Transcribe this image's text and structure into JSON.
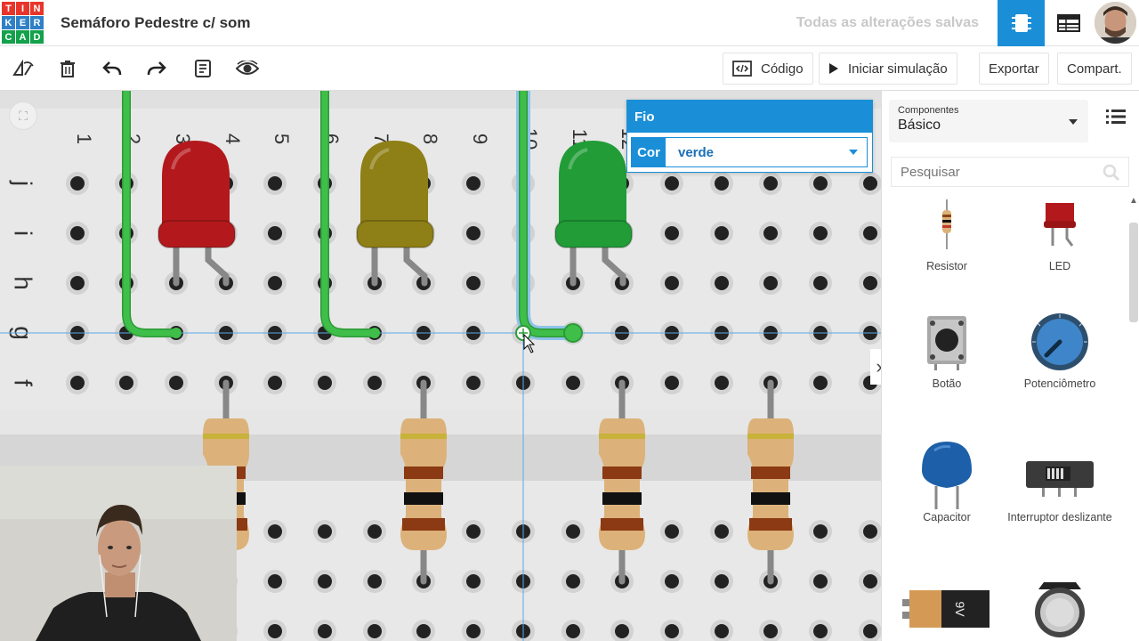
{
  "header": {
    "logo_letters": [
      "T",
      "I",
      "N",
      "K",
      "E",
      "R",
      "C",
      "A",
      "D"
    ],
    "logo_colors": [
      "#e8352b",
      "#e8352b",
      "#e8352b",
      "#2f80c6",
      "#2f80c6",
      "#2f80c6",
      "#13a14b",
      "#13a14b",
      "#13a14b"
    ],
    "title": "Semáforo Pedestre c/ som",
    "save_status": "Todas as alterações salvas"
  },
  "toolbar": {
    "code_label": "Código",
    "sim_label": "Iniciar simulação",
    "export_label": "Exportar",
    "share_label": "Compart."
  },
  "breadboard": {
    "column_numbers": [
      "1",
      "2",
      "3",
      "4",
      "5",
      "6",
      "7",
      "8",
      "9",
      "10",
      "11",
      "12"
    ],
    "row_letters": [
      "j",
      "i",
      "h",
      "g",
      "f"
    ]
  },
  "wire_popup": {
    "title": "Fio",
    "color_label": "Cor",
    "color_value": "verde"
  },
  "panel": {
    "components_label": "Componentes",
    "components_value": "Básico",
    "search_placeholder": "Pesquisar",
    "items": [
      {
        "label": "Resistor",
        "icon": "resistor-icon"
      },
      {
        "label": "LED",
        "icon": "led-icon"
      },
      {
        "label": "Botão",
        "icon": "pushbutton-icon"
      },
      {
        "label": "Potenciômetro",
        "icon": "potentiometer-icon"
      },
      {
        "label": "Capacitor",
        "icon": "capacitor-icon"
      },
      {
        "label": "Interruptor deslizante",
        "icon": "slide-switch-icon"
      },
      {
        "label": "",
        "icon": "battery-9v-icon",
        "text": "9V"
      },
      {
        "label": "",
        "icon": "coin-battery-icon"
      }
    ]
  },
  "colors": {
    "accent": "#1a8fd8",
    "wire_green": "#3fbf4a",
    "led_red": "#b3191c",
    "led_yellow": "#8e7f16",
    "led_green": "#219c37"
  }
}
